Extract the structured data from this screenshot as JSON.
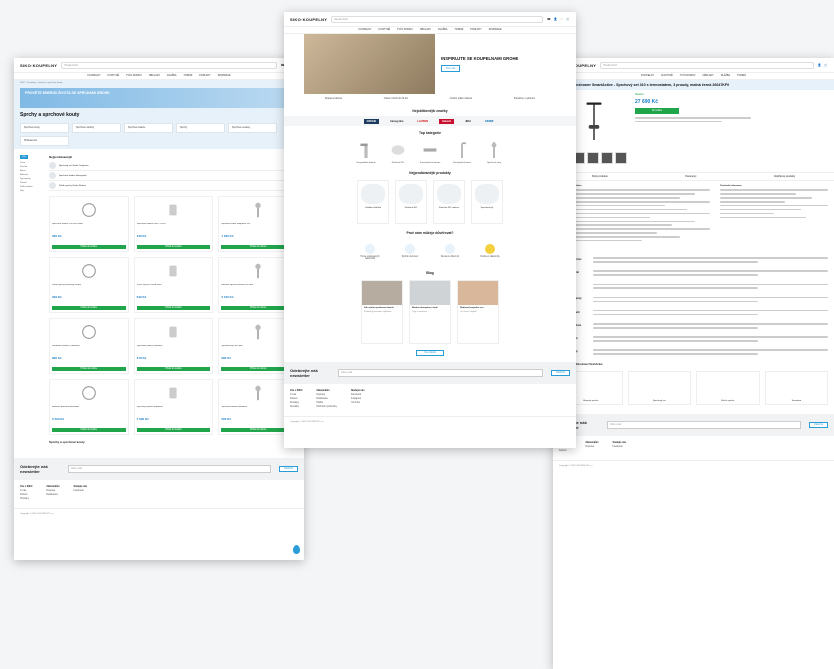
{
  "brand": {
    "logo": "SIKO·KOUPELNY"
  },
  "header": {
    "search_placeholder": "Hledat zboží",
    "icons": [
      "phone-icon",
      "user-icon",
      "heart-icon",
      "cart-icon"
    ],
    "cart_label": "Košík"
  },
  "nav": [
    "Koupelny",
    "Kuchyně",
    "Tvůj Domov",
    "Obklady",
    "Dlažba",
    "Topení",
    "Podlahy",
    "Inspirace"
  ],
  "colors": {
    "accent": "#2a9cd8",
    "buy": "#21a54b",
    "price": "#1a7dc4"
  },
  "left": {
    "breadcrumb": "SIKO › Koupelny › Sprchy a sprchové kouty",
    "banner": "PROVĚTE ENERGII ŽIVOTA SE SPRCHAMI GROHE",
    "heading": "Sprchy a sprchové kouty",
    "chips": [
      "Sprchové kouty",
      "Sprchové vaničky",
      "Sprchové baterie",
      "Sprchy",
      "Sprchové sestavy",
      "Příslušenství",
      "Sprchové hlavice",
      "Ruční sprchy",
      "Sprchové hadice"
    ],
    "filter_selected": "Filtr",
    "filters": [
      "Cena",
      "Značka",
      "Barva",
      "Materiál",
      "Typ sprchy",
      "Povrch",
      "Délka hadice",
      "Styl"
    ],
    "top_title": "Nejprodávanější",
    "top_items": [
      {
        "name": "Sprchový set Grohe Tempesta",
        "btn": "Do košíku"
      },
      {
        "name": "Sprchová hadice Hansgrohe",
        "btn": "Do košíku"
      },
      {
        "name": "Držák sprchy Grohe Relexa",
        "btn": "Do košíku"
      }
    ],
    "products": [
      {
        "name": "Sprchová hadice 150 cm chrom",
        "price": "399 Kč"
      },
      {
        "name": "Sprchová hadice Flex 175 cm",
        "price": "449 Kč"
      },
      {
        "name": "Sprchová sada Tempesta 100",
        "price": "1 290 Kč"
      },
      {
        "name": "Držák sprchy nástěnný chrom",
        "price": "329 Kč"
      },
      {
        "name": "Ruční sprcha Vitalio Start",
        "price": "549 Kč"
      },
      {
        "name": "Hlavová sprcha hranatá 250 mm",
        "price": "2 190 Kč"
      },
      {
        "name": "Nástěnné kolínko s držákem",
        "price": "890 Kč"
      },
      {
        "name": "Sprchová hadice Silverflex",
        "price": "479 Kč"
      },
      {
        "name": "Sprchová tyč 600 mm",
        "price": "990 Kč"
      },
      {
        "name": "Hlavová sprcha Rainshower",
        "price": "3 490 Kč"
      },
      {
        "name": "Sprchový systém Euphoria",
        "price": "7 990 Kč"
      },
      {
        "name": "Sprchová hadice Metalflex",
        "price": "529 Kč"
      }
    ],
    "cart_btn": "Přidat do košíku",
    "about_title": "Sprchy a sprchové kouty"
  },
  "center": {
    "hero_title": "INSPIRUJTE SE KOUPELNAMI GROHE",
    "hero_btn": "Více info",
    "usps": [
      "Doprava zdarma",
      "Vrácení zboží do 30 dní",
      "Osobní odběr zdarma",
      "Poradíme s výběrem"
    ],
    "brands_title": "Nejoblíbenější značky",
    "brands": [
      "GROHE",
      "hansgrohe",
      "LAUFEN",
      "Geberit",
      "JIKA",
      "KERMI"
    ],
    "cats_title": "Top kategorie",
    "cats": [
      "Umyvadlové baterie",
      "Závěsná WC",
      "Termostatické baterie",
      "Kuchyňské baterie",
      "Sprchové sety"
    ],
    "recs_title": "Nejprodávanější produkty",
    "recs": [
      "Ovládací tlačítko",
      "Závěsné WC",
      "Závěsné WC rimless",
      "Sprchová tyč"
    ],
    "why_title": "Proč nám můžeje důvěřovat?",
    "why": [
      "Tisíce spokojených zákazníků",
      "Rychlé doručení",
      "Zkušení odborníci",
      "Ověřeno zákazníky"
    ],
    "blog_title": "Blog",
    "posts": [
      {
        "title": "Jak vybrat sprchovou baterii",
        "text": "Praktický průvodce výběrem"
      },
      {
        "title": "Moderní koupelna v bytě",
        "text": "Tipy a inspirace"
      },
      {
        "title": "Rodinná koupelna snů",
        "text": "Co nesmí chybět"
      }
    ],
    "blog_btn": "Více článků",
    "news_title": "Odebírejte náš newsletter",
    "news_placeholder": "Váš e-mail",
    "news_btn": "Odebírat",
    "foot_cols": [
      {
        "head": "Vše o SIKO",
        "items": [
          "O nás",
          "Kariéra",
          "Prodejny",
          "Kontakty"
        ]
      },
      {
        "head": "Zákazníkům",
        "items": [
          "Doprava",
          "Reklamace",
          "Platba",
          "Obchodní podmínky"
        ]
      },
      {
        "head": "Sledujte nás",
        "items": [
          "Facebook",
          "Instagram",
          "YouTube"
        ]
      }
    ],
    "copyright": "Copyright © SIKO KOUPELNY a.s."
  },
  "right": {
    "title": "Grohe Rainshower SmartActive - Sprchový set 310 s termostatem, 3 proudy, matná černá 26647KF0",
    "stock": "Skladem",
    "price": "27 690 Kč",
    "buy": "Do košíku",
    "tabs": [
      "Popis produktu",
      "Parametry",
      "Doplňkové produkty"
    ],
    "desc_title": "Informace o produktu",
    "spec_title": "Technické informace",
    "features_title": "Klíčové funkce",
    "features": [
      "SmartActive",
      "Termostat",
      "EcoJoy",
      "DreamSpray",
      "CoolTouch",
      "SpeedClean",
      "QuickFix",
      "3 proudy"
    ],
    "acc_title": "Produkty série Rainshower SmartActive",
    "acc": [
      "Hlavová sprcha",
      "Sprchový set",
      "Ruční sprcha",
      "Termostat"
    ]
  }
}
